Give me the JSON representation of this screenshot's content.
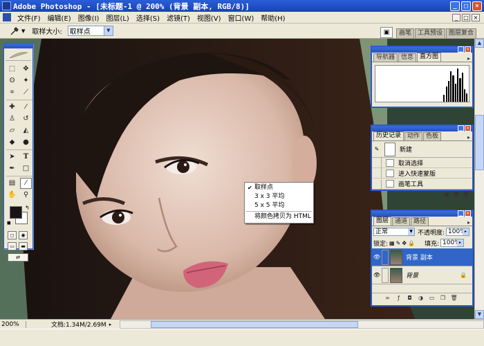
{
  "window": {
    "title": "Adobe Photoshop - [未标题-1 @ 200% (背景 副本, RGB/8)]",
    "buttons": [
      "_",
      "□",
      "×"
    ]
  },
  "menubar": {
    "items": [
      "文件(F)",
      "编辑(E)",
      "图像(I)",
      "图层(L)",
      "选择(S)",
      "滤镜(T)",
      "视图(V)",
      "窗口(W)",
      "帮助(H)"
    ],
    "mdi_buttons": [
      "_",
      "□",
      "×"
    ]
  },
  "options": {
    "sample_size_label": "取样大小:",
    "sample_size_value": "取样点"
  },
  "palette_well": {
    "tabs": [
      "画笔",
      "工具预设",
      "图层复合"
    ]
  },
  "navigator_palette": {
    "tabs": [
      "导航器",
      "信息",
      "直方图"
    ],
    "active_tab": "直方图"
  },
  "history_palette": {
    "tabs": [
      "历史记录",
      "动作",
      "色板"
    ],
    "snapshot_label": "新建",
    "items": [
      "取消选择",
      "进入快速蒙版",
      "画笔工具"
    ]
  },
  "layers_palette": {
    "tabs": [
      "图层",
      "通道",
      "路径"
    ],
    "blend_mode": "正常",
    "opacity_label": "不透明度:",
    "opacity_value": "100%",
    "lock_label": "锁定:",
    "fill_label": "填充:",
    "fill_value": "100%",
    "layers": [
      {
        "name": "背景 副本",
        "selected": true
      },
      {
        "name": "背景",
        "selected": false
      }
    ]
  },
  "context_menu": {
    "items": [
      "取样点",
      "3 x 3 平均",
      "5 x 5 平均",
      "将颜色拷贝为 HTML"
    ],
    "checked_item": "取样点"
  },
  "status": {
    "zoom": "200%",
    "doc": "文档:1.34M/2.69M"
  },
  "colors": {
    "foreground": "#1a1418",
    "background": "#ffffff",
    "title_blue": "#2450c0",
    "selected_layer": "#3166c8"
  }
}
